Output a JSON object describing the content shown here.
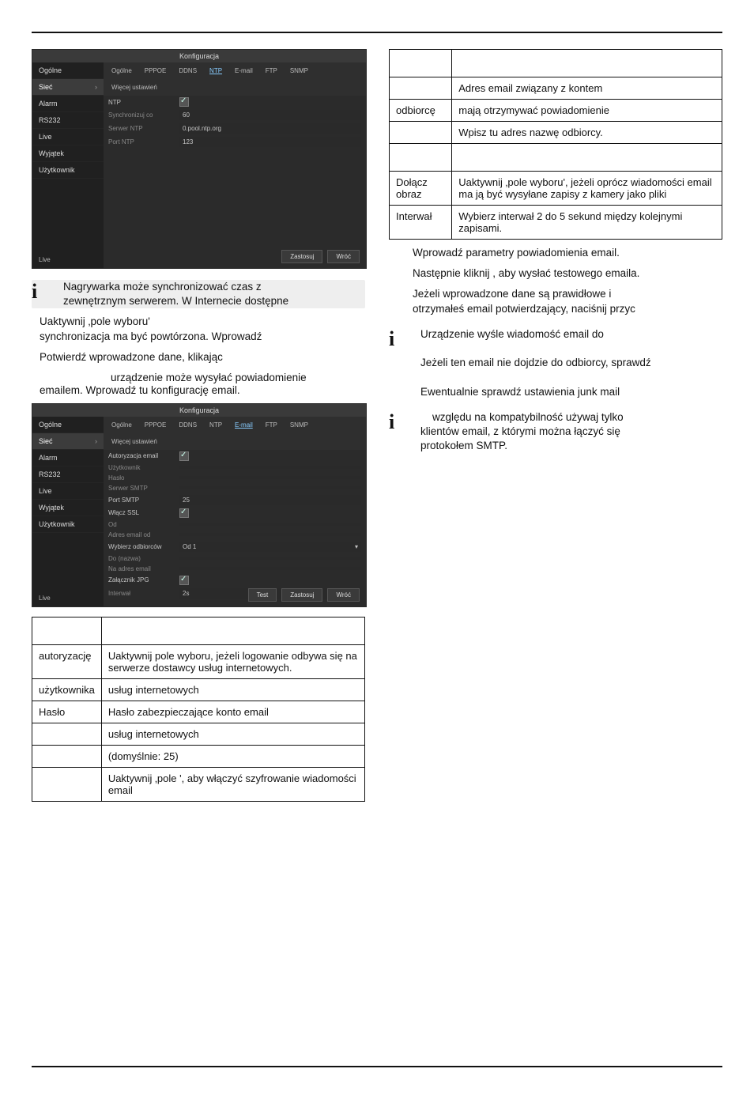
{
  "panel1": {
    "title": "Konfiguracja",
    "side": [
      "Ogólne",
      "Sieć",
      "Alarm",
      "RS232",
      "Live",
      "Wyjątek",
      "Użytkownik"
    ],
    "tabs": [
      "Ogólne",
      "PPPOE",
      "DDNS",
      "NTP",
      "E-mail",
      "FTP",
      "SNMP",
      "Więcej ustawień"
    ],
    "form": {
      "ntp_label": "NTP",
      "sync_label": "Synchronizuj co",
      "sync_value": "60",
      "server_label": "Serwer NTP",
      "server_value": "0.pool.ntp.org",
      "port_label": "Port NTP",
      "port_value": "123"
    },
    "live": "Live",
    "buttons": {
      "apply": "Zastosuj",
      "back": "Wróć"
    }
  },
  "panel2": {
    "title": "Konfiguracja",
    "side": [
      "Ogólne",
      "Sieć",
      "Alarm",
      "RS232",
      "Live",
      "Wyjątek",
      "Użytkownik"
    ],
    "tabs": [
      "Ogólne",
      "PPPOE",
      "DDNS",
      "NTP",
      "E-mail",
      "FTP",
      "SNMP",
      "Więcej ustawień"
    ],
    "f": {
      "auth": "Autoryzacja email",
      "user": "Użytkownik",
      "pass": "Hasło",
      "smtp": "Serwer SMTP",
      "smtpport": "Port SMTP",
      "smtpport_v": "25",
      "ssl": "Włącz SSL",
      "from": "Od",
      "fromaddr": "Adres email od",
      "selrecv": "Wybierz odbiorców",
      "selrecv_v": "Od 1",
      "toname": "Do (nazwa)",
      "toaddr": "Na adres email",
      "attach": "Załącznik JPG",
      "interval": "Interwał",
      "interval_v": "2s"
    },
    "live": "Live",
    "buttons": {
      "test": "Test",
      "apply": "Zastosuj",
      "back": "Wróć"
    }
  },
  "left": {
    "info1": {
      "line1": "Nagrywarka może synchronizować czas z",
      "line2": "zewnętrznym serwerem. W Internecie dostępne"
    },
    "p1a": "Uaktywnij ‚pole wyboru'",
    "p1b": "synchronizacja ma być powtórzona. Wprowadź",
    "p2": "Potwierdź wprowadzone dane, klikając",
    "p3a": "urządzenie może wysyłać powiadomienie",
    "p3b": "emailem. Wprowadź tu konfigurację email."
  },
  "table_left": [
    {
      "k": "autoryzację",
      "v": "Uaktywnij pole wyboru, jeżeli logowanie odbywa się na serwerze dostawcy usług internetowych."
    },
    {
      "k": "użytkownika",
      "v": "usług internetowych"
    },
    {
      "k": "Hasło",
      "v": "Hasło zabezpieczające konto email"
    },
    {
      "k": "",
      "v": "usług internetowych"
    },
    {
      "k": "",
      "v": "(domyślnie: 25)"
    },
    {
      "k": "",
      "v": "Uaktywnij ‚pole           ', aby włączyć szyfrowanie wiadomości email"
    }
  ],
  "table_right": [
    {
      "k": "",
      "v": "Adres email związany z kontem"
    },
    {
      "k": "odbiorcę",
      "v": "mają otrzymywać powiadomienie"
    },
    {
      "k": "",
      "v": "Wpisz tu adres nazwę odbiorcy."
    },
    {
      "k": "Dołącz obraz",
      "v": "Uaktywnij ‚pole wyboru', jeżeli oprócz wiadomości email ma ją być wysyłane zapisy z kamery jako pliki"
    },
    {
      "k": "Interwał",
      "v": "Wybierz interwał 2 do 5 sekund między kolejnymi zapisami."
    }
  ],
  "right": {
    "p1": "Wprowadź parametry powiadomienia email.",
    "p2": "Następnie kliknij        , aby wysłać testowego emaila.",
    "p3a": "Jeżeli wprowadzone dane są prawidłowe i",
    "p3b": "otrzymałeś email potwierdzający, naciśnij przyc",
    "info1": {
      "a": "Urządzenie wyśle wiadomość email do",
      "b": "Jeżeli ten email nie dojdzie do odbiorcy, sprawdź",
      "c": "Ewentualnie sprawdź ustawienia junk mail"
    },
    "info2": {
      "a": "względu na kompatybilność używaj tylko",
      "b": "klientów email, z którymi można łączyć się",
      "c": "protokołem SMTP."
    }
  }
}
